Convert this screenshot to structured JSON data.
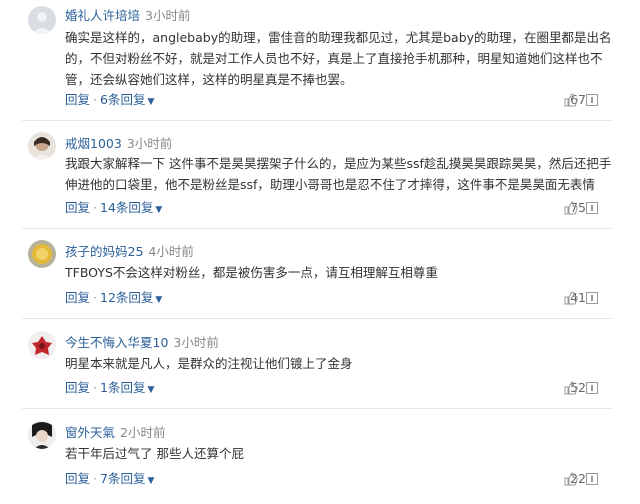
{
  "comments": [
    {
      "username": "婚礼人许培培",
      "time": "3小时前",
      "text": "确实是这样的，anglebaby的助理，雷佳音的助理我都见过，尤其是baby的助理，在圈里都是出名的，不但对粉丝不好，就是对工作人员也不好，真是上了直接抢手机那种，明星知道她们这样也不管，还会纵容她们这样，这样的明星真是不捧也罢。",
      "reply_label": "回复",
      "reply_count": "6条回复",
      "likes": "67",
      "avatar": "avatar-gray"
    },
    {
      "username": "戒烟1003",
      "time": "3小时前",
      "text": "我跟大家解释一下 这件事不是昊昊摆架子什么的，是应为某些ssf趁乱摸昊昊跟踪昊昊，然后还把手伸进他的口袋里，他不是粉丝是ssf，助理小哥哥也是忍不住了才摔得，这件事不是昊昊面无表情",
      "reply_label": "回复",
      "reply_count": "14条回复",
      "likes": "75",
      "avatar": "avatar-person"
    },
    {
      "username": "孩子的妈妈25",
      "time": "4小时前",
      "text": "TFBOYS不会这样对粉丝，都是被伤害多一点，请互相理解互相尊重",
      "reply_label": "回复",
      "reply_count": "12条回复",
      "likes": "41",
      "avatar": "avatar-yellow"
    },
    {
      "username": "今生不悔入华夏10",
      "time": "3小时前",
      "text": "明星本来就是凡人，是群众的注视让他们镀上了金身",
      "reply_label": "回复",
      "reply_count": "1条回复",
      "likes": "52",
      "avatar": "avatar-red"
    },
    {
      "username": "窗外天氣",
      "time": "2小时前",
      "text": "若干年后过气了 那些人还算个屁",
      "reply_label": "回复",
      "reply_count": "7条回复",
      "likes": "22",
      "avatar": "avatar-dark"
    }
  ],
  "colors": {
    "username": "#2b5f99",
    "link": "#2b5f99",
    "time": "#888888",
    "text": "#333333",
    "divider": "#e8e8e8"
  },
  "icons": {
    "like": "thumbs-up-icon",
    "report": "report-icon",
    "expand": "chevron-down-icon"
  }
}
